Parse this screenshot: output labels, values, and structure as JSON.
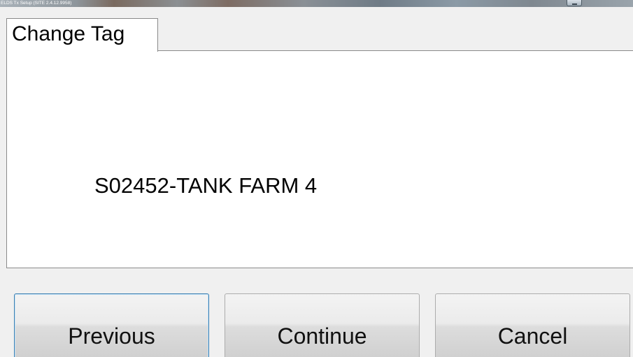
{
  "window": {
    "title": "ELDS Tx Setup (SITE 2.4.12.9958)"
  },
  "tabs": [
    {
      "label": "Change Tag"
    }
  ],
  "content": {
    "tag": "S02452-TANK FARM 4"
  },
  "buttons": {
    "previous": "Previous",
    "continue": "Continue",
    "cancel": "Cancel"
  }
}
